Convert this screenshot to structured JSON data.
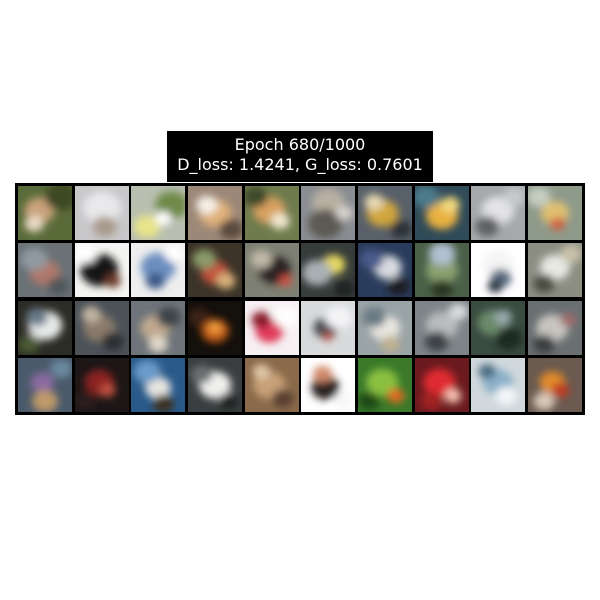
{
  "title": {
    "line1": "Epoch 680/1000",
    "line2": "D_loss: 1.4241, G_loss: 0.7601"
  },
  "grid": {
    "rows": 4,
    "cols": 10,
    "tiles": [
      {
        "bg": "#5a6b3a",
        "blobs": [
          [
            "#c9a27a",
            0.4,
            0.45,
            0.28
          ],
          [
            "#3d4a22",
            0.8,
            0.2,
            0.3
          ],
          [
            "#e8d9c4",
            0.3,
            0.7,
            0.18
          ]
        ]
      },
      {
        "bg": "#c8c7c9",
        "blobs": [
          [
            "#e9e8ea",
            0.5,
            0.4,
            0.35
          ],
          [
            "#a89a8c",
            0.55,
            0.75,
            0.22
          ]
        ]
      },
      {
        "bg": "#b8bfb0",
        "blobs": [
          [
            "#e8e48a",
            0.3,
            0.75,
            0.25
          ],
          [
            "#6f8a4a",
            0.75,
            0.35,
            0.3
          ],
          [
            "#ffffff",
            0.6,
            0.6,
            0.15
          ]
        ]
      },
      {
        "bg": "#9c8878",
        "blobs": [
          [
            "#e0b07a",
            0.5,
            0.5,
            0.3
          ],
          [
            "#f4efe6",
            0.35,
            0.35,
            0.2
          ],
          [
            "#5a4a3c",
            0.8,
            0.8,
            0.22
          ]
        ]
      },
      {
        "bg": "#6f7b4d",
        "blobs": [
          [
            "#d8a060",
            0.45,
            0.45,
            0.3
          ],
          [
            "#f0e6cc",
            0.65,
            0.65,
            0.18
          ],
          [
            "#3c4a2a",
            0.2,
            0.2,
            0.22
          ]
        ]
      },
      {
        "bg": "#8a8d92",
        "blobs": [
          [
            "#b9b0a2",
            0.5,
            0.3,
            0.3
          ],
          [
            "#5c5a52",
            0.45,
            0.7,
            0.32
          ],
          [
            "#d6d2cc",
            0.8,
            0.5,
            0.16
          ]
        ]
      },
      {
        "bg": "#58606a",
        "blobs": [
          [
            "#d0a63c",
            0.45,
            0.5,
            0.3
          ],
          [
            "#e6d8b0",
            0.3,
            0.3,
            0.18
          ],
          [
            "#2a3038",
            0.8,
            0.8,
            0.2
          ]
        ]
      },
      {
        "bg": "#2f4a58",
        "blobs": [
          [
            "#e8b040",
            0.5,
            0.55,
            0.3
          ],
          [
            "#4b7a8a",
            0.2,
            0.2,
            0.25
          ],
          [
            "#f2d87c",
            0.65,
            0.35,
            0.18
          ]
        ]
      },
      {
        "bg": "#a6a9ac",
        "blobs": [
          [
            "#e4e4e6",
            0.5,
            0.45,
            0.3
          ],
          [
            "#5e6064",
            0.3,
            0.75,
            0.22
          ],
          [
            "#c7cacd",
            0.8,
            0.2,
            0.2
          ]
        ]
      },
      {
        "bg": "#8e9a8a",
        "blobs": [
          [
            "#e0c070",
            0.5,
            0.5,
            0.26
          ],
          [
            "#d06040",
            0.55,
            0.7,
            0.14
          ],
          [
            "#c4cdc0",
            0.2,
            0.2,
            0.22
          ]
        ]
      },
      {
        "bg": "#6a7276",
        "blobs": [
          [
            "#b0786a",
            0.5,
            0.55,
            0.28
          ],
          [
            "#8f9aa0",
            0.3,
            0.3,
            0.25
          ],
          [
            "#50585c",
            0.75,
            0.8,
            0.2
          ]
        ]
      },
      {
        "bg": "#f4f4f2",
        "blobs": [
          [
            "#161616",
            0.45,
            0.5,
            0.35
          ],
          [
            "#6a3a2a",
            0.7,
            0.7,
            0.15
          ],
          [
            "#ffffff",
            0.2,
            0.2,
            0.2
          ]
        ]
      },
      {
        "bg": "#eeeeee",
        "blobs": [
          [
            "#6a8ec0",
            0.5,
            0.45,
            0.32
          ],
          [
            "#3e5a88",
            0.45,
            0.7,
            0.18
          ],
          [
            "#ffffff",
            0.8,
            0.2,
            0.18
          ]
        ]
      },
      {
        "bg": "#3c3428",
        "blobs": [
          [
            "#c0503a",
            0.5,
            0.55,
            0.26
          ],
          [
            "#8a9a6a",
            0.3,
            0.3,
            0.22
          ],
          [
            "#d8b078",
            0.7,
            0.7,
            0.18
          ]
        ]
      },
      {
        "bg": "#7d8072",
        "blobs": [
          [
            "#2a2420",
            0.55,
            0.5,
            0.3
          ],
          [
            "#c0b8a8",
            0.3,
            0.3,
            0.2
          ],
          [
            "#d05040",
            0.75,
            0.7,
            0.12
          ]
        ]
      },
      {
        "bg": "#363c3a",
        "blobs": [
          [
            "#e6d860",
            0.6,
            0.4,
            0.22
          ],
          [
            "#a8b0b4",
            0.3,
            0.55,
            0.28
          ],
          [
            "#1c2024",
            0.8,
            0.85,
            0.18
          ]
        ]
      },
      {
        "bg": "#2a3c5c",
        "blobs": [
          [
            "#d8dce0",
            0.55,
            0.45,
            0.26
          ],
          [
            "#4a5a8a",
            0.25,
            0.3,
            0.22
          ],
          [
            "#1a1c24",
            0.75,
            0.8,
            0.2
          ]
        ]
      },
      {
        "bg": "#4a6048",
        "blobs": [
          [
            "#8aa070",
            0.5,
            0.5,
            0.3
          ],
          [
            "#b0c0d0",
            0.5,
            0.2,
            0.25
          ],
          [
            "#2a3624",
            0.5,
            0.85,
            0.2
          ]
        ]
      },
      {
        "bg": "#ffffff",
        "blobs": [
          [
            "#f4f4f4",
            0.5,
            0.4,
            0.3
          ],
          [
            "#5a6a80",
            0.55,
            0.65,
            0.2
          ],
          [
            "#2c3440",
            0.45,
            0.8,
            0.14
          ]
        ]
      },
      {
        "bg": "#8c8e82",
        "blobs": [
          [
            "#e6e8e2",
            0.5,
            0.45,
            0.28
          ],
          [
            "#4a4c40",
            0.3,
            0.75,
            0.2
          ],
          [
            "#c8c0a8",
            0.8,
            0.2,
            0.2
          ]
        ]
      },
      {
        "bg": "#2c2c26",
        "blobs": [
          [
            "#e8eaea",
            0.5,
            0.45,
            0.32
          ],
          [
            "#6a7a8a",
            0.35,
            0.3,
            0.2
          ],
          [
            "#4a5a30",
            0.2,
            0.8,
            0.2
          ]
        ]
      },
      {
        "bg": "#4c5258",
        "blobs": [
          [
            "#8a7a6a",
            0.45,
            0.5,
            0.3
          ],
          [
            "#2a2e30",
            0.7,
            0.75,
            0.2
          ],
          [
            "#c0b4a0",
            0.3,
            0.25,
            0.18
          ]
        ]
      },
      {
        "bg": "#6e747a",
        "blobs": [
          [
            "#c0a890",
            0.45,
            0.5,
            0.28
          ],
          [
            "#3e4448",
            0.7,
            0.3,
            0.22
          ],
          [
            "#e0d8c8",
            0.5,
            0.8,
            0.18
          ]
        ]
      },
      {
        "bg": "#14100c",
        "blobs": [
          [
            "#c05a18",
            0.5,
            0.55,
            0.26
          ],
          [
            "#f0a040",
            0.5,
            0.5,
            0.12
          ],
          [
            "#3a2414",
            0.2,
            0.3,
            0.2
          ]
        ]
      },
      {
        "bg": "#f6f0f2",
        "blobs": [
          [
            "#e03a5a",
            0.45,
            0.55,
            0.26
          ],
          [
            "#8a1a2a",
            0.3,
            0.35,
            0.18
          ],
          [
            "#ffffff",
            0.75,
            0.3,
            0.22
          ]
        ]
      },
      {
        "bg": "#d8dadc",
        "blobs": [
          [
            "#4a4e52",
            0.45,
            0.5,
            0.22
          ],
          [
            "#f4f4f6",
            0.7,
            0.3,
            0.25
          ],
          [
            "#b05040",
            0.5,
            0.65,
            0.1
          ]
        ]
      },
      {
        "bg": "#9aa4a6",
        "blobs": [
          [
            "#e8e6e0",
            0.5,
            0.5,
            0.28
          ],
          [
            "#6a7a84",
            0.3,
            0.3,
            0.22
          ],
          [
            "#c0b090",
            0.6,
            0.8,
            0.18
          ]
        ]
      },
      {
        "bg": "#7e8488",
        "blobs": [
          [
            "#b8bcbc",
            0.5,
            0.45,
            0.3
          ],
          [
            "#3c4246",
            0.4,
            0.75,
            0.22
          ],
          [
            "#d8dcdc",
            0.8,
            0.2,
            0.18
          ]
        ]
      },
      {
        "bg": "#3a4c40",
        "blobs": [
          [
            "#6a8a6a",
            0.4,
            0.4,
            0.28
          ],
          [
            "#1e2c24",
            0.7,
            0.7,
            0.25
          ],
          [
            "#9aaab0",
            0.6,
            0.3,
            0.16
          ]
        ]
      },
      {
        "bg": "#6a7072",
        "blobs": [
          [
            "#c8c4c0",
            0.45,
            0.5,
            0.3
          ],
          [
            "#a06a6a",
            0.75,
            0.35,
            0.15
          ],
          [
            "#3a3e40",
            0.3,
            0.8,
            0.2
          ]
        ]
      },
      {
        "bg": "#4a5a6a",
        "blobs": [
          [
            "#8a6aa0",
            0.45,
            0.45,
            0.22
          ],
          [
            "#c09a6a",
            0.5,
            0.8,
            0.24
          ],
          [
            "#6a8aa0",
            0.8,
            0.2,
            0.2
          ]
        ]
      },
      {
        "bg": "#1c1616",
        "blobs": [
          [
            "#8a2020",
            0.45,
            0.45,
            0.28
          ],
          [
            "#c05040",
            0.6,
            0.6,
            0.15
          ],
          [
            "#2a1a1a",
            0.2,
            0.8,
            0.2
          ]
        ]
      },
      {
        "bg": "#2a5a8a",
        "blobs": [
          [
            "#e8e6e0",
            0.5,
            0.55,
            0.24
          ],
          [
            "#6a9ac8",
            0.3,
            0.25,
            0.25
          ],
          [
            "#3a3020",
            0.6,
            0.85,
            0.2
          ]
        ]
      },
      {
        "bg": "#3a3e40",
        "blobs": [
          [
            "#f0f0ee",
            0.5,
            0.5,
            0.3
          ],
          [
            "#6a6e70",
            0.25,
            0.3,
            0.2
          ],
          [
            "#1e2022",
            0.75,
            0.8,
            0.18
          ]
        ]
      },
      {
        "bg": "#8a6a4a",
        "blobs": [
          [
            "#c8a078",
            0.45,
            0.5,
            0.3
          ],
          [
            "#5a4030",
            0.7,
            0.75,
            0.2
          ],
          [
            "#e0c8a8",
            0.3,
            0.25,
            0.16
          ]
        ]
      },
      {
        "bg": "#ffffff",
        "blobs": [
          [
            "#2a2220",
            0.45,
            0.55,
            0.26
          ],
          [
            "#d08a6a",
            0.4,
            0.3,
            0.18
          ],
          [
            "#f8f8f8",
            0.8,
            0.8,
            0.2
          ]
        ]
      },
      {
        "bg": "#3a7a2a",
        "blobs": [
          [
            "#8ac040",
            0.45,
            0.45,
            0.3
          ],
          [
            "#e06a20",
            0.7,
            0.7,
            0.16
          ],
          [
            "#1e4a18",
            0.2,
            0.8,
            0.2
          ]
        ]
      },
      {
        "bg": "#6a1a1e",
        "blobs": [
          [
            "#e02a30",
            0.45,
            0.45,
            0.3
          ],
          [
            "#f4c0b0",
            0.7,
            0.7,
            0.16
          ],
          [
            "#a02020",
            0.3,
            0.8,
            0.2
          ]
        ]
      },
      {
        "bg": "#d0d8dc",
        "blobs": [
          [
            "#8ab0c8",
            0.5,
            0.45,
            0.28
          ],
          [
            "#f4f6f8",
            0.65,
            0.7,
            0.2
          ],
          [
            "#4a6a80",
            0.3,
            0.25,
            0.16
          ]
        ]
      },
      {
        "bg": "#6a5a50",
        "blobs": [
          [
            "#e08a2a",
            0.45,
            0.45,
            0.24
          ],
          [
            "#c03a20",
            0.6,
            0.6,
            0.16
          ],
          [
            "#d8c8b8",
            0.3,
            0.8,
            0.2
          ]
        ]
      }
    ]
  }
}
